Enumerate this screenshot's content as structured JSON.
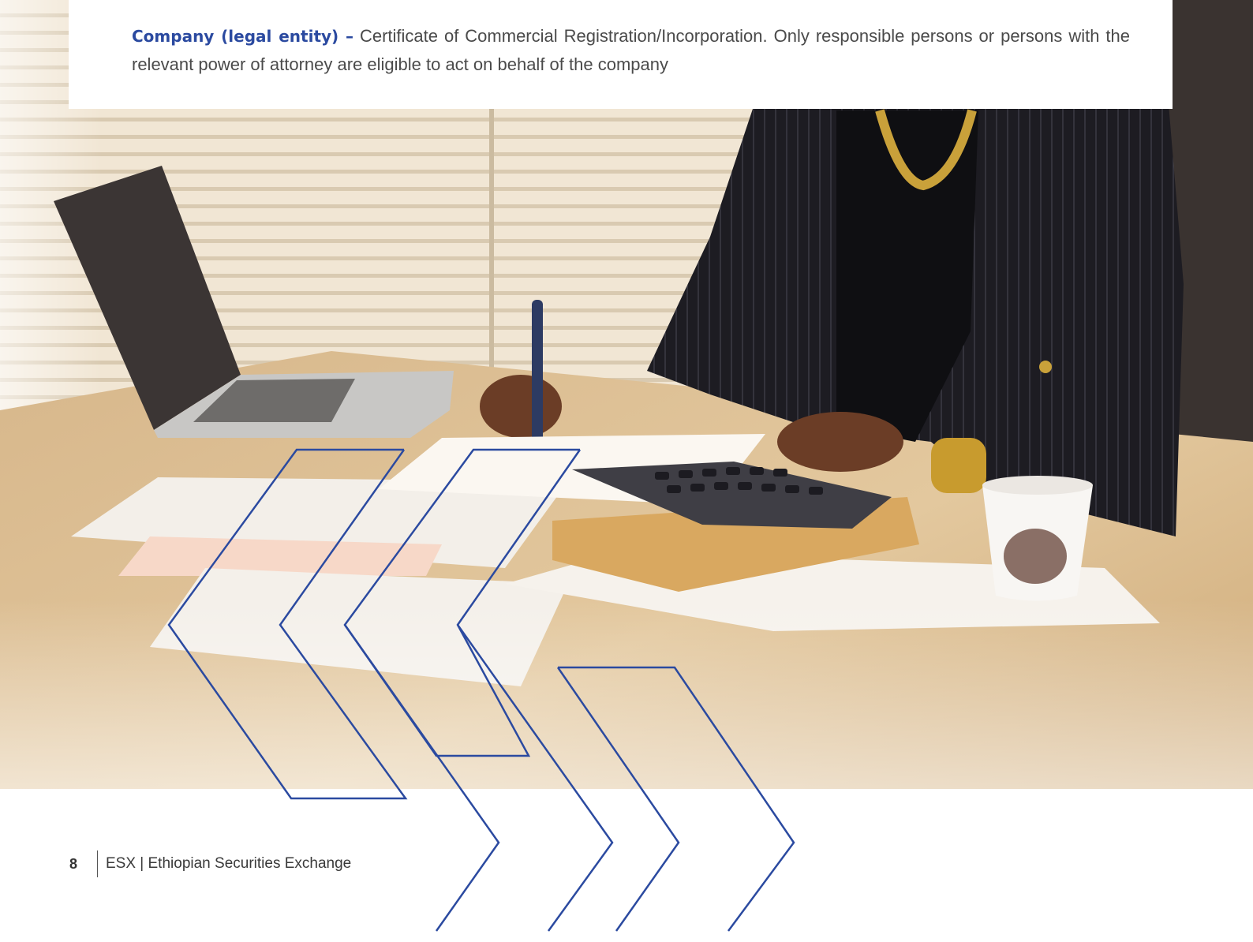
{
  "body_text": {
    "lead": "Company (legal entity) –",
    "text": " Certificate of Commercial Registration/Incorporation. Only responsible persons or persons with the relevant power of attorney are eligible to act on behalf of the company"
  },
  "footer": {
    "page_number": "8",
    "publication": "ESX | Ethiopian Securities Exchange"
  },
  "colors": {
    "accent_blue": "#2b4aa0",
    "body_text": "#4a4a4a"
  },
  "photo": {
    "subject": "photo-office-desk"
  }
}
